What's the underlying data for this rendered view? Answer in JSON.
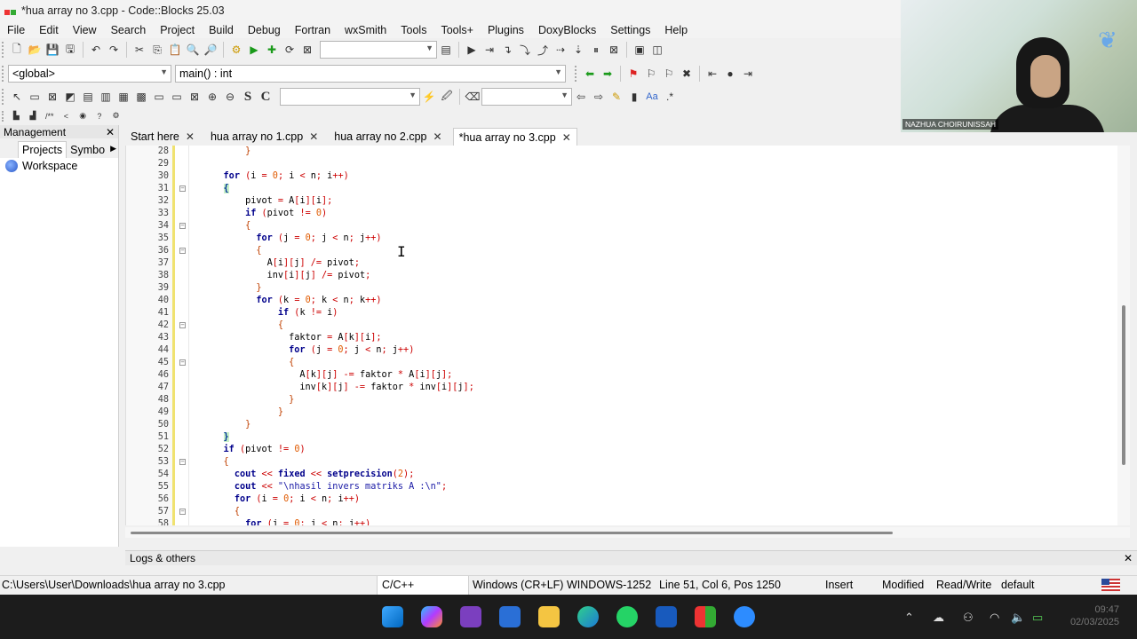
{
  "window": {
    "title": "*hua array no 3.cpp - Code::Blocks 25.03"
  },
  "menu": [
    "File",
    "Edit",
    "View",
    "Search",
    "Project",
    "Build",
    "Debug",
    "Fortran",
    "wxSmith",
    "Tools",
    "Tools+",
    "Plugins",
    "DoxyBlocks",
    "Settings",
    "Help"
  ],
  "scope": {
    "global": "<global>",
    "function": "main() : int"
  },
  "management": {
    "title": "Management",
    "tabs": [
      "Projects",
      "Symbo"
    ],
    "workspace": "Workspace"
  },
  "editor_tabs": [
    {
      "label": "Start here"
    },
    {
      "label": "hua array no 1.cpp"
    },
    {
      "label": "hua array no 2.cpp"
    },
    {
      "label": "*hua array no 3.cpp",
      "active": true
    }
  ],
  "code_lines": [
    {
      "n": "28",
      "text": "        }"
    },
    {
      "n": "29",
      "text": ""
    },
    {
      "n": "30",
      "text": "    for (i = 0; i < n; i++)"
    },
    {
      "n": "31",
      "text": "    {"
    },
    {
      "n": "32",
      "text": "        pivot = A[i][i];"
    },
    {
      "n": "33",
      "text": "        if (pivot != 0)"
    },
    {
      "n": "34",
      "text": "        {"
    },
    {
      "n": "35",
      "text": "          for (j = 0; j < n; j++)"
    },
    {
      "n": "36",
      "text": "          {"
    },
    {
      "n": "37",
      "text": "            A[i][j] /= pivot;"
    },
    {
      "n": "38",
      "text": "            inv[i][j] /= pivot;"
    },
    {
      "n": "39",
      "text": "          }"
    },
    {
      "n": "40",
      "text": "          for (k = 0; k < n; k++)"
    },
    {
      "n": "41",
      "text": "              if (k != i)"
    },
    {
      "n": "42",
      "text": "              {"
    },
    {
      "n": "43",
      "text": "                faktor = A[k][i];"
    },
    {
      "n": "44",
      "text": "                for (j = 0; j < n; j++)"
    },
    {
      "n": "45",
      "text": "                {"
    },
    {
      "n": "46",
      "text": "                  A[k][j] -= faktor * A[i][j];"
    },
    {
      "n": "47",
      "text": "                  inv[k][j] -= faktor * inv[i][j];"
    },
    {
      "n": "48",
      "text": "                }"
    },
    {
      "n": "49",
      "text": "              }"
    },
    {
      "n": "50",
      "text": "        }"
    },
    {
      "n": "51",
      "text": "    }"
    },
    {
      "n": "52",
      "text": "    if (pivot != 0)"
    },
    {
      "n": "53",
      "text": "    {"
    },
    {
      "n": "54",
      "text": "      cout << fixed << setprecision(2);"
    },
    {
      "n": "55",
      "text": "      cout << \"\\nhasil invers matriks A :\\n\";"
    },
    {
      "n": "56",
      "text": "      for (i = 0; i < n; i++)"
    },
    {
      "n": "57",
      "text": "      {"
    },
    {
      "n": "58",
      "text": "        for (j = 0; j < n; j++)"
    }
  ],
  "logs": {
    "title": "Logs & others"
  },
  "status": {
    "path": "C:\\Users\\User\\Downloads\\hua array no 3.cpp",
    "language": "C/C++",
    "eol": "Windows (CR+LF)",
    "encoding": "WINDOWS-1252",
    "position": "Line 51, Col 6, Pos 1250",
    "insert": "Insert",
    "modified": "Modified",
    "rw": "Read/Write",
    "profile": "default"
  },
  "video": {
    "participant": "NAZHUA CHOIRUNISSAH"
  },
  "clock": {
    "time": "09:47",
    "date": "02/03/2025"
  }
}
